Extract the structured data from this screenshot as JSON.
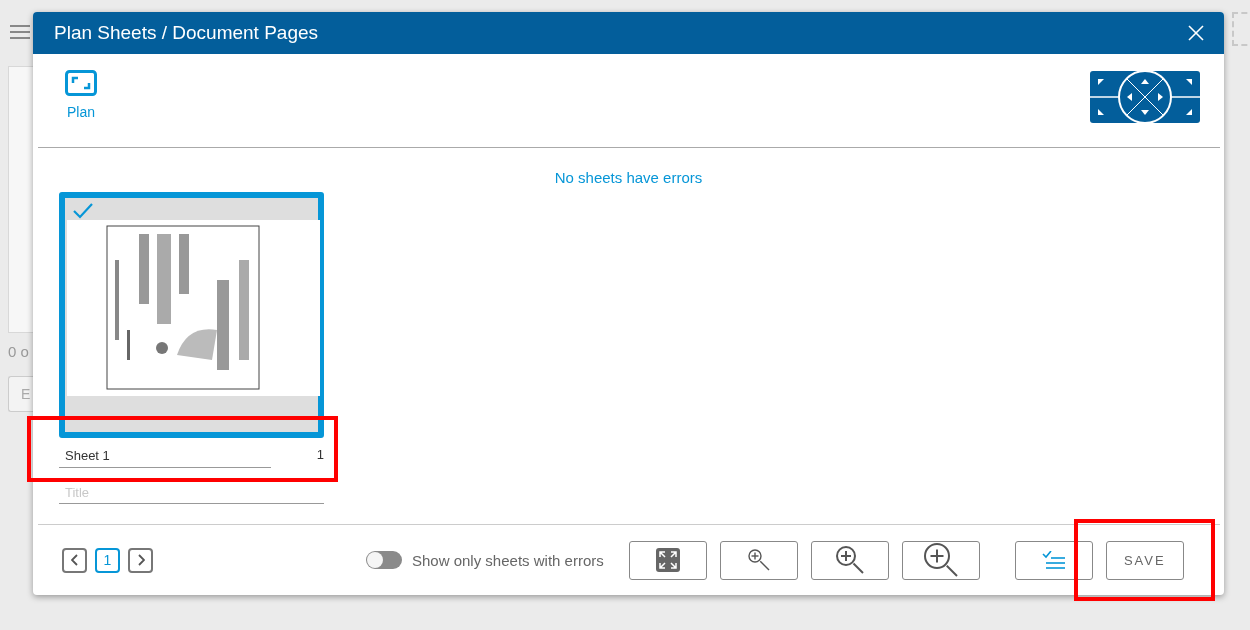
{
  "background": {
    "fragments": [
      "0 o",
      "E"
    ]
  },
  "dialog": {
    "title": "Plan Sheets / Document Pages",
    "view_tabs": [
      {
        "label": "Plan",
        "selected": true
      }
    ],
    "message": "No sheets have errors",
    "sheets": [
      {
        "name": "Sheet 1",
        "number": "1",
        "title_placeholder": "Title",
        "selected": true,
        "highlighted": true
      }
    ],
    "pager": {
      "pages": [
        {
          "label": "1",
          "selected": true
        }
      ]
    },
    "filter_toggle": {
      "label": "Show only sheets with errors",
      "on": false
    },
    "tools": [
      {
        "kind": "fit"
      },
      {
        "kind": "zoom-small"
      },
      {
        "kind": "zoom-medium"
      },
      {
        "kind": "zoom-large"
      },
      {
        "kind": "checklist"
      }
    ],
    "save_button": {
      "label": "SAVE",
      "highlighted": true
    }
  }
}
